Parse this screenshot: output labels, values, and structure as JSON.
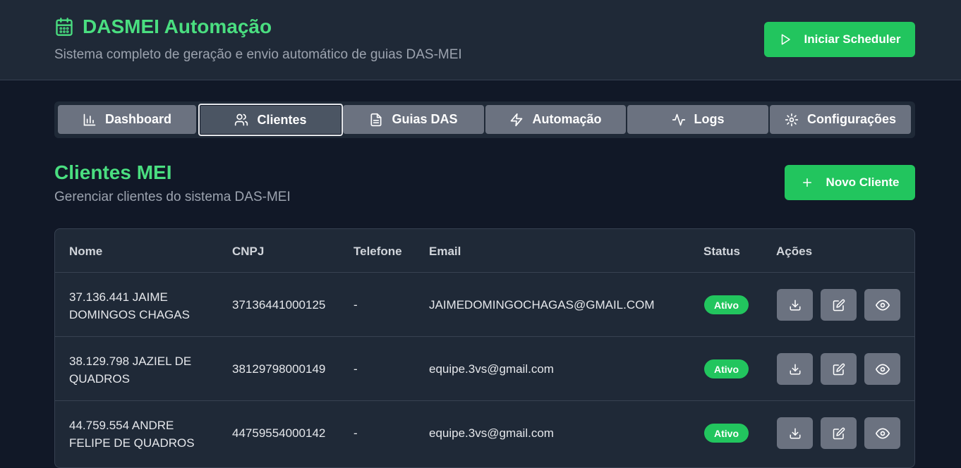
{
  "header": {
    "title": "DASMEI Automação",
    "subtitle": "Sistema completo de geração e envio automático de guias DAS-MEI",
    "scheduler_label": "Iniciar Scheduler",
    "title_icon": "calendar-icon"
  },
  "tabs": [
    {
      "label": "Dashboard",
      "icon": "bar-chart-icon",
      "active": false
    },
    {
      "label": "Clientes",
      "icon": "users-icon",
      "active": true
    },
    {
      "label": "Guias DAS",
      "icon": "file-text-icon",
      "active": false
    },
    {
      "label": "Automação",
      "icon": "zap-icon",
      "active": false
    },
    {
      "label": "Logs",
      "icon": "activity-icon",
      "active": false
    },
    {
      "label": "Configurações",
      "icon": "settings-icon",
      "active": false
    }
  ],
  "section": {
    "title": "Clientes MEI",
    "subtitle": "Gerenciar clientes do sistema DAS-MEI",
    "new_label": "Novo Cliente"
  },
  "table": {
    "headers": [
      "Nome",
      "CNPJ",
      "Telefone",
      "Email",
      "Status",
      "Ações"
    ],
    "rows": [
      {
        "name_line1": "37.136.441 JAIME",
        "name_line2": "DOMINGOS CHAGAS",
        "cnpj": "37136441000125",
        "phone": "-",
        "email": "JAIMEDOMINGOCHAGAS@GMAIL.COM",
        "status": "Ativo"
      },
      {
        "name_line1": "38.129.798 JAZIEL DE",
        "name_line2": "QUADROS",
        "cnpj": "38129798000149",
        "phone": "-",
        "email": "equipe.3vs@gmail.com",
        "status": "Ativo"
      },
      {
        "name_line1": "44.759.554 ANDRE",
        "name_line2": "FELIPE DE QUADROS",
        "cnpj": "44759554000142",
        "phone": "-",
        "email": "equipe.3vs@gmail.com",
        "status": "Ativo"
      }
    ]
  },
  "colors": {
    "accent": "#4ade80",
    "button": "#22c55e",
    "background": "#111827",
    "panel": "#1f2937"
  }
}
